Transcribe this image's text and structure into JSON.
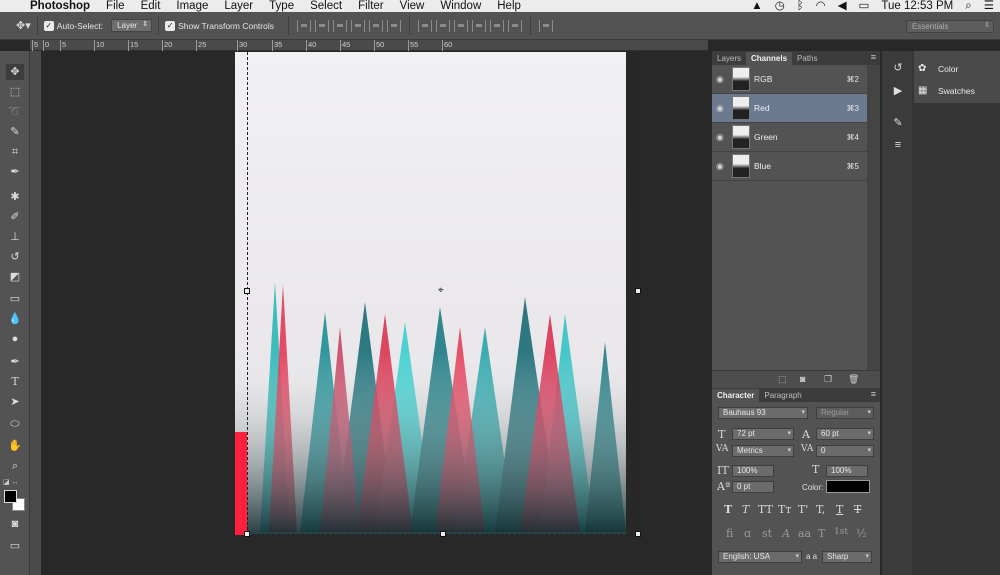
{
  "menubar": {
    "apple_icon": "apple-icon",
    "app_name": "Photoshop",
    "menus": [
      "File",
      "Edit",
      "Image",
      "Layer",
      "Type",
      "Select",
      "Filter",
      "View",
      "Window",
      "Help"
    ],
    "clock": "Tue 12:53 PM",
    "status_icons": [
      "notification-icon",
      "time-machine-icon",
      "bluetooth-icon",
      "wifi-icon",
      "volume-icon",
      "battery-icon",
      "spotlight-icon",
      "list-icon"
    ]
  },
  "options_bar": {
    "auto_select_label": "Auto-Select:",
    "auto_select_value": "Layer",
    "show_transform_label": "Show Transform Controls",
    "workspace_value": "Essentials"
  },
  "ruler": {
    "h_ticks": [
      "5",
      "0",
      "5",
      "10",
      "15",
      "20",
      "25",
      "30",
      "35",
      "40",
      "45",
      "50",
      "55",
      "60"
    ]
  },
  "tools": [
    "move-tool-icon",
    "marquee-tool-icon",
    "lasso-tool-icon",
    "quick-select-tool-icon",
    "crop-tool-icon",
    "eyedropper-tool-icon",
    "healing-brush-icon",
    "brush-tool-icon",
    "clone-stamp-icon",
    "history-brush-icon",
    "eraser-tool-icon",
    "gradient-tool-icon",
    "blur-tool-icon",
    "dodge-tool-icon",
    "pen-tool-icon",
    "type-tool-icon",
    "path-select-icon",
    "ellipse-tool-icon",
    "hand-tool-icon",
    "zoom-tool-icon"
  ],
  "channels_panel": {
    "tabs": [
      "Layers",
      "Channels",
      "Paths"
    ],
    "active_tab": "Channels",
    "channels": [
      {
        "name": "RGB",
        "shortcut": "⌘2"
      },
      {
        "name": "Red",
        "shortcut": "⌘3"
      },
      {
        "name": "Green",
        "shortcut": "⌘4"
      },
      {
        "name": "Blue",
        "shortcut": "⌘5"
      }
    ],
    "selected_channel": "Red"
  },
  "character_panel": {
    "tabs": [
      "Character",
      "Paragraph"
    ],
    "font_family": "Bauhaus 93",
    "font_style": "Regular",
    "font_size": "72 pt",
    "leading": "60 pt",
    "kerning": "Metrics",
    "tracking": "0",
    "vertical_scale": "100%",
    "horizontal_scale": "100%",
    "baseline_shift": "0 pt",
    "color_label": "Color:",
    "color_value": "#000000",
    "language": "English: USA",
    "antialias_label": "a a",
    "antialias": "Sharp",
    "style_glyphs": [
      "T",
      "T",
      "TT",
      "Tт",
      "T'",
      "T,",
      "T",
      "T"
    ],
    "opentype_glyphs": [
      "fi",
      "ɑ",
      "st",
      "A",
      "aa",
      "T",
      "1st",
      "½"
    ]
  },
  "right_dock": {
    "items": [
      {
        "label": "Color",
        "icon": "palette-icon"
      },
      {
        "label": "Swatches",
        "icon": "grid-icon"
      }
    ]
  }
}
